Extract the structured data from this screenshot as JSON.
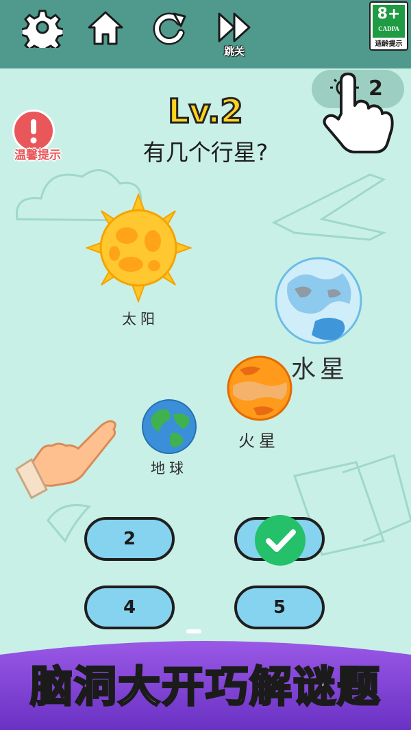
{
  "toolbar": {
    "settings_icon": "gear-icon",
    "home_icon": "home-icon",
    "restart_icon": "restart-icon",
    "skip_icon": "fast-forward-icon",
    "skip_label": "跳关"
  },
  "age_rating": {
    "rating": "8+",
    "org": "CADPA",
    "label": "适龄提示"
  },
  "hint": {
    "icon": "lightbulb-icon",
    "count": "2"
  },
  "tip": {
    "icon": "exclamation-icon",
    "label": "温馨提示"
  },
  "level": {
    "title": "Lv.2",
    "question": "有几个行星?"
  },
  "bodies": {
    "sun": "太阳",
    "mercury": "水星",
    "mars": "火星",
    "earth": "地球"
  },
  "answers": [
    "2",
    "",
    "4",
    "5"
  ],
  "banner": {
    "text": "脑洞大开巧解谜题"
  },
  "colors": {
    "background": "#c9f0e6",
    "topbar": "#4f9a8c",
    "answer_button": "#86d3ef",
    "check": "#25c06a",
    "level_title": "#ffd21f",
    "banner": "#7b3fd3"
  }
}
